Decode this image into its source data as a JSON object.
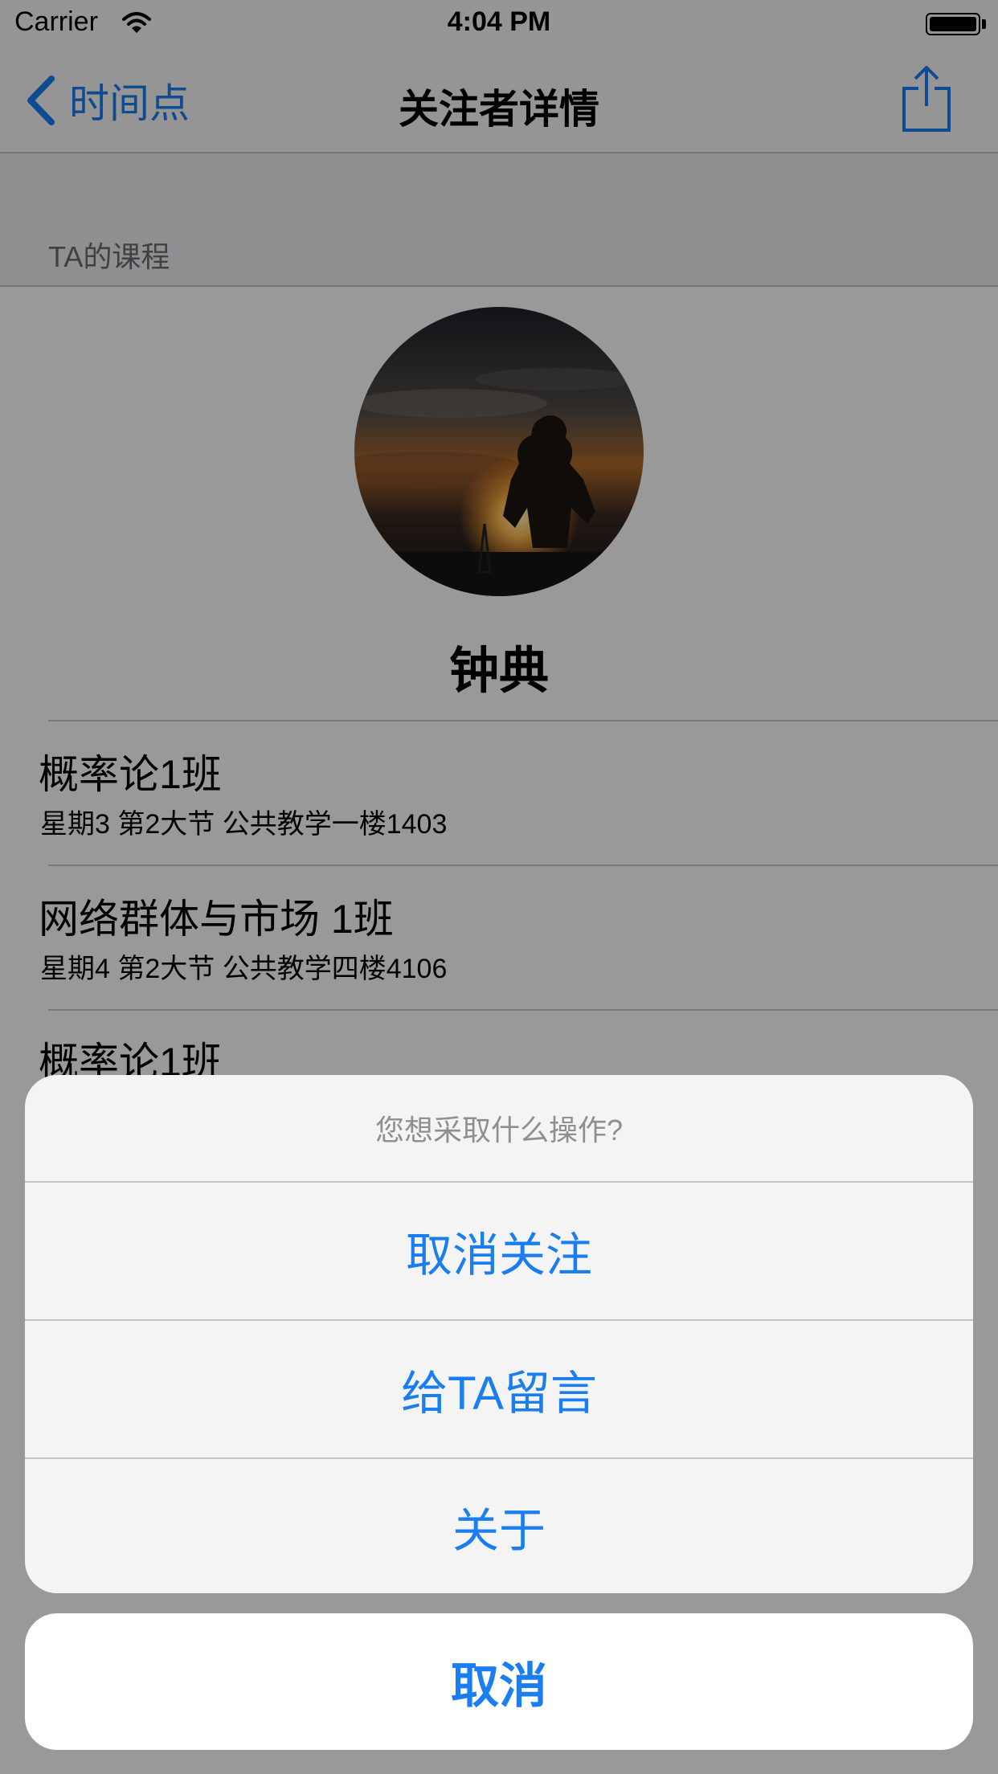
{
  "status_bar": {
    "carrier": "Carrier",
    "time": "4:04 PM"
  },
  "nav": {
    "back_label": "时间点",
    "title": "关注者详情"
  },
  "section": {
    "label": "TA的课程"
  },
  "profile": {
    "name": "钟典"
  },
  "courses": [
    {
      "title": "概率论1班",
      "detail": "星期3 第2大节 公共教学一楼1403"
    },
    {
      "title": "网络群体与市场 1班",
      "detail": "星期4 第2大节 公共教学四楼4106"
    },
    {
      "title": "概率论1班"
    }
  ],
  "action_sheet": {
    "title": "您想采取什么操作?",
    "actions": [
      "取消关注",
      "给TA留言",
      "关于"
    ],
    "cancel": "取消"
  },
  "colors": {
    "accent": "#1a7ef0",
    "dim": "rgba(0,0,0,0.40)"
  }
}
